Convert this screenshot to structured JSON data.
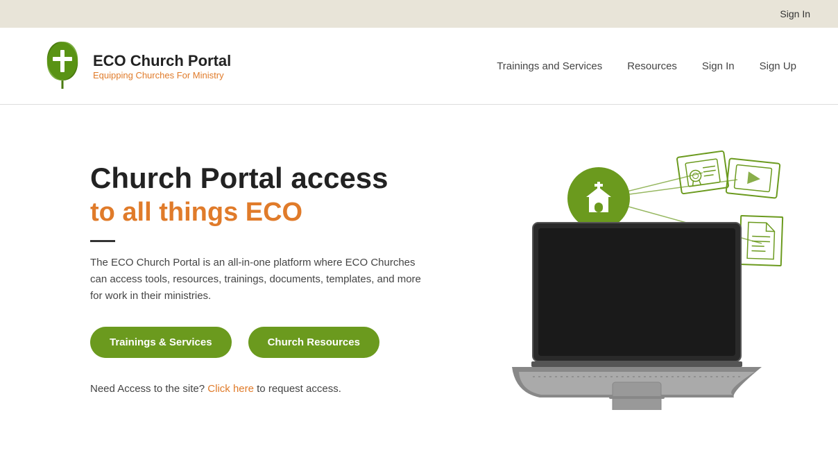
{
  "topbar": {
    "signin_label": "Sign In"
  },
  "header": {
    "logo_title": "ECO Church Portal",
    "logo_subtitle": "Equipping Churches For Ministry",
    "nav": {
      "trainings": "Trainings and Services",
      "resources": "Resources",
      "signin": "Sign In",
      "signup": "Sign Up"
    }
  },
  "hero": {
    "title": "Church Portal access",
    "subtitle": "to all things ECO",
    "description": "The ECO Church Portal is an all-in-one platform where ECO Churches can access tools, resources, trainings, documents, templates, and more for work in their ministries.",
    "btn_trainings": "Trainings & Services",
    "btn_resources": "Church Resources",
    "access_text": "Need Access to the site?",
    "access_link": "Click here",
    "access_suffix": " to request access."
  }
}
